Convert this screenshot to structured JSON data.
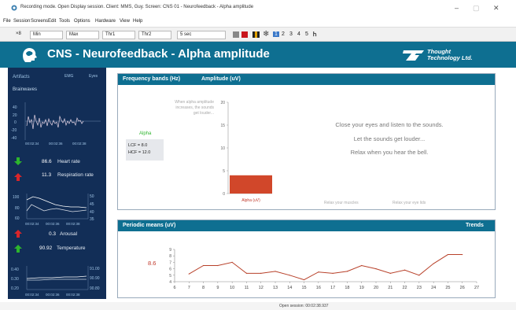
{
  "window": {
    "title": "Recording mode. Open Display session. Client: MMS, Guy. Screen: CNS 01 - Neurofeedback - Alpha amplitude",
    "minimize": "–",
    "maximize": "▢",
    "close": "✕"
  },
  "menu": [
    "File",
    "Session",
    "Screens",
    "Edit",
    "Tools",
    "Options",
    "Hardware",
    "View",
    "Help"
  ],
  "toolbar": {
    "field1_prefix": "×8",
    "field1": "Min",
    "field2": "Max",
    "field3": "Thr1",
    "field4": "Thr2",
    "field5": "5 sec",
    "screens": [
      "1",
      "2",
      "3",
      "4",
      "5"
    ]
  },
  "header": {
    "title": "CNS - Neurofeedback - Alpha amplitude",
    "brand_line1": "Thought",
    "brand_line2": "Technology Ltd."
  },
  "sidebar": {
    "tabs": {
      "artifacts": "Artifacts",
      "emg": "EMG",
      "eyes": "Eyes"
    },
    "brainwaves": "Brainwaves",
    "eeg_chart": {
      "yticks": [
        "40",
        "20",
        "0",
        "-20",
        "-40"
      ],
      "xticks": [
        "00:02:34",
        "00:02:36",
        "00:02:38"
      ]
    },
    "heart_rate": {
      "value": "86.6",
      "label": "Heart rate"
    },
    "respiration_rate": {
      "value": "11.3",
      "label": "Respiration rate"
    },
    "hr_chart": {
      "yticks_left": [
        "100",
        "80",
        "60"
      ],
      "yticks_right": [
        "50",
        "45",
        "40",
        "35"
      ],
      "xticks": [
        "00:02:34",
        "00:02:36",
        "00:02:38"
      ]
    },
    "arousal": {
      "value": "0.3",
      "label": "Arousal"
    },
    "temperature": {
      "value": "90.92",
      "label": "Temperature"
    },
    "temp_chart": {
      "yticks_left": [
        "0.40",
        "0.30",
        "0.20"
      ],
      "yticks_right": [
        "91.00",
        "90.90",
        "90.80"
      ],
      "xticks": [
        "00:02:34",
        "00:02:36",
        "00:02:38"
      ]
    },
    "colors": {
      "up": "#2db52d",
      "down": "#d9252a"
    }
  },
  "bands_panel": {
    "title": "Frequency bands (Hz)",
    "subtitle": "Amplitude (uV)",
    "hint": "When alpha amplitude increases, the sounds get louder...",
    "band_name": "Alpha",
    "lcf": "LCF = 8.0",
    "hcf": "HCF = 12.0",
    "messages": [
      "Close your eyes and listen to the sounds.",
      "Let the sounds get louder...",
      "Relax when you hear the bell."
    ],
    "relax_muscles": "Relax your muscles",
    "relax_eyelids": "Relax your eye lids"
  },
  "bar_chart": {
    "type": "bar",
    "categories": [
      "Alpha (uV)"
    ],
    "values": [
      4
    ],
    "ylim": [
      0,
      20
    ],
    "yticks": [
      0,
      5,
      10,
      15,
      20
    ],
    "bar_color": "#d1472a"
  },
  "means_panel": {
    "title": "Periodic means (uV)",
    "trends": "Trends",
    "current_value": "8.6"
  },
  "chart_data": {
    "type": "line",
    "x": [
      7,
      8,
      9,
      10,
      11,
      12,
      13,
      14,
      15,
      16,
      17,
      18,
      19,
      20,
      21,
      22,
      23,
      24,
      25,
      26
    ],
    "series": [
      {
        "values": [
          5.2,
          6.5,
          6.5,
          7.0,
          5.3,
          5.3,
          5.6,
          5.0,
          4.3,
          5.5,
          5.3,
          5.6,
          6.5,
          6.0,
          5.3,
          5.8,
          5.0,
          6.8,
          8.2,
          8.2
        ]
      }
    ],
    "xlim": [
      6,
      27
    ],
    "xticks": [
      6,
      7,
      8,
      9,
      10,
      11,
      12,
      13,
      14,
      15,
      16,
      17,
      18,
      19,
      20,
      21,
      22,
      23,
      24,
      25,
      26,
      27
    ],
    "ylim": [
      4,
      9
    ],
    "yticks": [
      4,
      5,
      6,
      7,
      8,
      9
    ],
    "line_color": "#b8412a"
  },
  "status": {
    "text": "Open session: 00:02:38.937"
  }
}
